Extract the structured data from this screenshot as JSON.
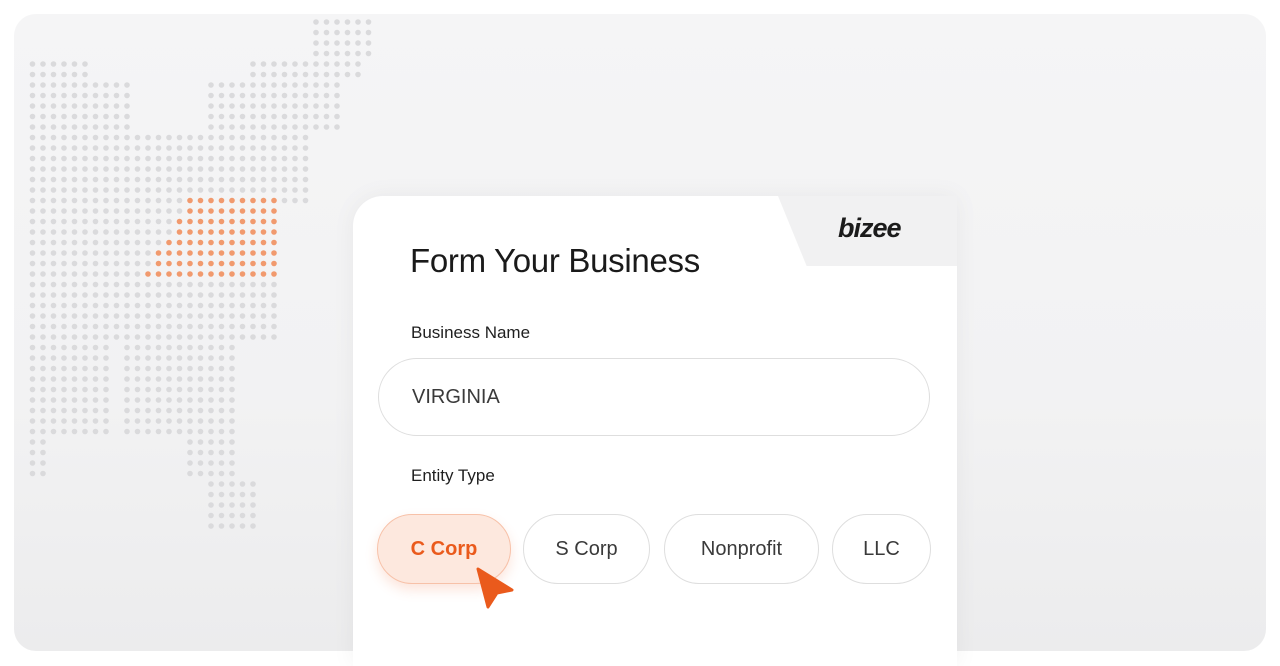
{
  "brand": {
    "logo_text": "bizee"
  },
  "form": {
    "title": "Form Your Business",
    "business_name_label": "Business Name",
    "business_name_value": "VIRGINIA",
    "entity_type_label": "Entity Type",
    "entity_options": [
      "C Corp",
      "S Corp",
      "Nonprofit",
      "LLC"
    ],
    "selected_entity": "C Corp"
  },
  "colors": {
    "accent": "#ea5a1c",
    "accent_soft": "#fde8de",
    "map_dot": "#dadadc",
    "map_highlight": "#f19a6e"
  },
  "icons": {
    "cursor": "arrow-cursor-icon",
    "map": "us-dot-map"
  }
}
